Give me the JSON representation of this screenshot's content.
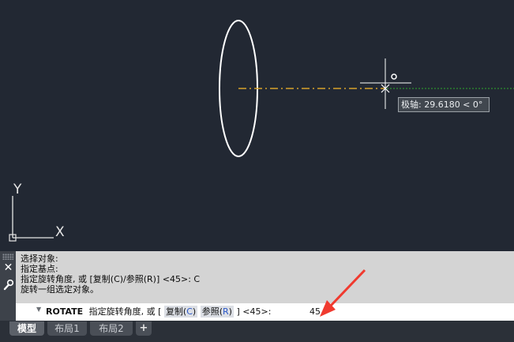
{
  "canvas": {
    "ucs": {
      "y_label": "Y",
      "x_label": "X"
    },
    "tooltip": {
      "text": "极轴: 29.6180 < 0°"
    }
  },
  "command_history": [
    "选择对象:",
    "指定基点:",
    "指定旋转角度, 或 [复制(C)/参照(R)] <45>:  C",
    "旋转一组选定对象。"
  ],
  "command_line": {
    "command": "ROTATE",
    "prompt": "指定旋转角度, 或 [",
    "option1": "复制(",
    "option1_key": "C",
    "option1_close": ")",
    "option2": "参照(",
    "option2_key": "R",
    "option2_close": ")",
    "default_text": "] <45>:",
    "input_value": "45"
  },
  "layout_tabs": [
    {
      "label": "模型",
      "active": true
    },
    {
      "label": "布局1",
      "active": false
    },
    {
      "label": "布局2",
      "active": false
    }
  ],
  "add_tab_label": "+",
  "colors": {
    "background": "#222833",
    "polar_tracking": "#d6a12b",
    "alignment_line": "#2ea82e",
    "annotation_arrow": "#f03a2f"
  }
}
